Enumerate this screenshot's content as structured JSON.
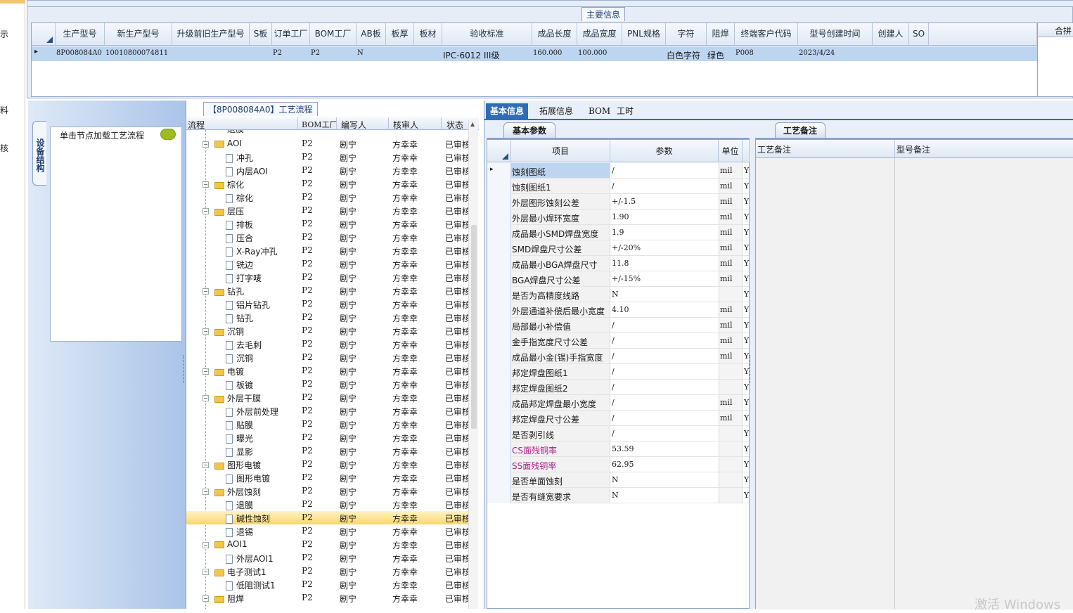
{
  "left_strip": {
    "items": [
      "示",
      "料",
      "核"
    ]
  },
  "top": {
    "group_label": "主要信息",
    "right_header": "合拼",
    "columns": [
      "生产型号",
      "新生产型号",
      "升级前旧生产型号",
      "S板",
      "订单工厂",
      "BOM工厂",
      "AB板",
      "板厚",
      "板材",
      "验收标准",
      "成品长度",
      "成品宽度",
      "PNL规格",
      "字符",
      "阻焊",
      "终端客户代码",
      "型号创建时间",
      "创建人",
      "SO"
    ],
    "row": {
      "marker": "▸",
      "cells": [
        "8P008084A0",
        "10010800074811",
        "",
        "",
        "P2",
        "P2",
        "N",
        "",
        "",
        "IPC-6012 III级",
        "160.000",
        "100.000",
        "",
        "白色字符",
        "绿色",
        "P008",
        "2023/4/24",
        "",
        ""
      ]
    }
  },
  "device": {
    "tab_label": "设备结构",
    "hint": "单击节点加载工艺流程"
  },
  "flow": {
    "title": "【8P008084A0】工艺流程",
    "columns": [
      "流程",
      "BOM工厂",
      "编写人",
      "核审人",
      "状态"
    ],
    "rows": [
      {
        "t": "f",
        "name": "AOI",
        "bom": "P2",
        "w": "剧宁",
        "r": "方幸幸",
        "s": "已审核"
      },
      {
        "t": "d",
        "name": "冲孔",
        "bom": "P2",
        "w": "剧宁",
        "r": "方幸幸",
        "s": "已审核"
      },
      {
        "t": "d",
        "name": "内层AOI",
        "bom": "P2",
        "w": "剧宁",
        "r": "方幸幸",
        "s": "已审核"
      },
      {
        "t": "f",
        "name": "棕化",
        "bom": "P2",
        "w": "剧宁",
        "r": "方幸幸",
        "s": "已审核"
      },
      {
        "t": "d",
        "name": "棕化",
        "bom": "P2",
        "w": "剧宁",
        "r": "方幸幸",
        "s": "已审核"
      },
      {
        "t": "f",
        "name": "层压",
        "bom": "P2",
        "w": "剧宁",
        "r": "方幸幸",
        "s": "已审核"
      },
      {
        "t": "d",
        "name": "排板",
        "bom": "P2",
        "w": "剧宁",
        "r": "方幸幸",
        "s": "已审核"
      },
      {
        "t": "d",
        "name": "压合",
        "bom": "P2",
        "w": "剧宁",
        "r": "方幸幸",
        "s": "已审核"
      },
      {
        "t": "d",
        "name": "X-Ray冲孔",
        "bom": "P2",
        "w": "剧宁",
        "r": "方幸幸",
        "s": "已审核"
      },
      {
        "t": "d",
        "name": "铣边",
        "bom": "P2",
        "w": "剧宁",
        "r": "方幸幸",
        "s": "已审核"
      },
      {
        "t": "d",
        "name": "打字唛",
        "bom": "P2",
        "w": "剧宁",
        "r": "方幸幸",
        "s": "已审核"
      },
      {
        "t": "f",
        "name": "钻孔",
        "bom": "P2",
        "w": "剧宁",
        "r": "方幸幸",
        "s": "已审核"
      },
      {
        "t": "d",
        "name": "铝片钻孔",
        "bom": "P2",
        "w": "剧宁",
        "r": "方幸幸",
        "s": "已审核"
      },
      {
        "t": "d",
        "name": "钻孔",
        "bom": "P2",
        "w": "剧宁",
        "r": "方幸幸",
        "s": "已审核"
      },
      {
        "t": "f",
        "name": "沉铜",
        "bom": "P2",
        "w": "剧宁",
        "r": "方幸幸",
        "s": "已审核"
      },
      {
        "t": "d",
        "name": "去毛刺",
        "bom": "P2",
        "w": "剧宁",
        "r": "方幸幸",
        "s": "已审核"
      },
      {
        "t": "d",
        "name": "沉铜",
        "bom": "P2",
        "w": "剧宁",
        "r": "方幸幸",
        "s": "已审核"
      },
      {
        "t": "f",
        "name": "电镀",
        "bom": "P2",
        "w": "剧宁",
        "r": "方幸幸",
        "s": "已审核"
      },
      {
        "t": "d",
        "name": "板镀",
        "bom": "P2",
        "w": "剧宁",
        "r": "方幸幸",
        "s": "已审核"
      },
      {
        "t": "f",
        "name": "外层干膜",
        "bom": "P2",
        "w": "剧宁",
        "r": "方幸幸",
        "s": "已审核"
      },
      {
        "t": "d",
        "name": "外层前处理",
        "bom": "P2",
        "w": "剧宁",
        "r": "方幸幸",
        "s": "已审核"
      },
      {
        "t": "d",
        "name": "贴膜",
        "bom": "P2",
        "w": "剧宁",
        "r": "方幸幸",
        "s": "已审核"
      },
      {
        "t": "d",
        "name": "曝光",
        "bom": "P2",
        "w": "剧宁",
        "r": "方幸幸",
        "s": "已审核"
      },
      {
        "t": "d",
        "name": "显影",
        "bom": "P2",
        "w": "剧宁",
        "r": "方幸幸",
        "s": "已审核"
      },
      {
        "t": "f",
        "name": "图形电镀",
        "bom": "P2",
        "w": "剧宁",
        "r": "方幸幸",
        "s": "已审核"
      },
      {
        "t": "d",
        "name": "图形电镀",
        "bom": "P2",
        "w": "剧宁",
        "r": "方幸幸",
        "s": "已审核"
      },
      {
        "t": "f",
        "name": "外层蚀刻",
        "bom": "P2",
        "w": "剧宁",
        "r": "方幸幸",
        "s": "已审核"
      },
      {
        "t": "d",
        "name": "退膜",
        "bom": "P2",
        "w": "剧宁",
        "r": "方幸幸",
        "s": "已审核"
      },
      {
        "t": "d",
        "name": "碱性蚀刻",
        "bom": "P2",
        "w": "剧宁",
        "r": "方幸幸",
        "s": "已审核",
        "hl": true
      },
      {
        "t": "d",
        "name": "退锡",
        "bom": "P2",
        "w": "剧宁",
        "r": "方幸幸",
        "s": "已审核"
      },
      {
        "t": "f",
        "name": "AOI1",
        "bom": "P2",
        "w": "剧宁",
        "r": "方幸幸",
        "s": "已审核"
      },
      {
        "t": "d",
        "name": "外层AOI1",
        "bom": "P2",
        "w": "剧宁",
        "r": "方幸幸",
        "s": "已审核"
      },
      {
        "t": "f",
        "name": "电子测试1",
        "bom": "P2",
        "w": "剧宁",
        "r": "方幸幸",
        "s": "已审核"
      },
      {
        "t": "d",
        "name": "低阻测试1",
        "bom": "P2",
        "w": "剧宁",
        "r": "方幸幸",
        "s": "已审核"
      },
      {
        "t": "f",
        "name": "阻焊",
        "bom": "P2",
        "w": "剧宁",
        "r": "方幸幸",
        "s": "已审核"
      }
    ],
    "top_partial": "退膜"
  },
  "right": {
    "tabs": [
      "基本信息",
      "拓展信息",
      "BOM",
      "工时"
    ],
    "basic_tab": "基本参数",
    "remark_tab": "工艺备注",
    "columns": [
      "项目",
      "参数",
      "单位",
      "Y"
    ],
    "rows": [
      {
        "item": "蚀刻图纸",
        "param": "/",
        "unit": "mil",
        "flag": "Y"
      },
      {
        "item": "蚀刻图纸1",
        "param": "/",
        "unit": "mil",
        "flag": "Y"
      },
      {
        "item": "外层图形蚀刻公差",
        "param": "+/-1.5",
        "unit": "mil",
        "flag": "Y"
      },
      {
        "item": "外层最小焊环宽度",
        "param": "1.90",
        "unit": "mil",
        "flag": "Y"
      },
      {
        "item": "成品最小SMD焊盘宽度",
        "param": "1.9",
        "unit": "mil",
        "flag": "Y"
      },
      {
        "item": "SMD焊盘尺寸公差",
        "param": "+/-20%",
        "unit": "mil",
        "flag": "Y"
      },
      {
        "item": "成品最小BGA焊盘尺寸",
        "param": "11.8",
        "unit": "mil",
        "flag": "Y"
      },
      {
        "item": "BGA焊盘尺寸公差",
        "param": "+/-15%",
        "unit": "mil",
        "flag": "Y"
      },
      {
        "item": "是否为高精度线路",
        "param": "N",
        "unit": "",
        "flag": "Y"
      },
      {
        "item": "外层通道补偿后最小宽度",
        "param": "4.10",
        "unit": "mil",
        "flag": "Y"
      },
      {
        "item": "局部最小补偿值",
        "param": "/",
        "unit": "mil",
        "flag": "Y"
      },
      {
        "item": "金手指宽度尺寸公差",
        "param": "/",
        "unit": "mil",
        "flag": "Y"
      },
      {
        "item": "成品最小金(锡)手指宽度",
        "param": "/",
        "unit": "mil",
        "flag": "Y"
      },
      {
        "item": "邦定焊盘图纸1",
        "param": "/",
        "unit": "",
        "flag": "Y"
      },
      {
        "item": "邦定焊盘图纸2",
        "param": "/",
        "unit": "",
        "flag": "Y"
      },
      {
        "item": "成品邦定焊盘最小宽度",
        "param": "/",
        "unit": "mil",
        "flag": "Y"
      },
      {
        "item": "邦定焊盘尺寸公差",
        "param": "/",
        "unit": "mil",
        "flag": "Y"
      },
      {
        "item": "是否剥引线",
        "param": "/",
        "unit": "",
        "flag": "Y"
      },
      {
        "item": "CS面残铜率",
        "param": "53.59",
        "unit": "",
        "flag": "Y",
        "pink": true
      },
      {
        "item": "SS面残铜率",
        "param": "62.95",
        "unit": "",
        "flag": "Y",
        "pink": true
      },
      {
        "item": "是否单面蚀刻",
        "param": "N",
        "unit": "",
        "flag": "Y"
      },
      {
        "item": "是否有缝宽要求",
        "param": "N",
        "unit": "",
        "flag": "Y"
      }
    ],
    "remark_columns": [
      "工艺备注",
      "型号备注"
    ]
  },
  "watermark": "激活 Windows",
  "colors": {
    "accent": "#2e6db5",
    "selected_row": "#bed5f0",
    "highlight": "#fbd66e",
    "pink_text": "#b0208a"
  }
}
